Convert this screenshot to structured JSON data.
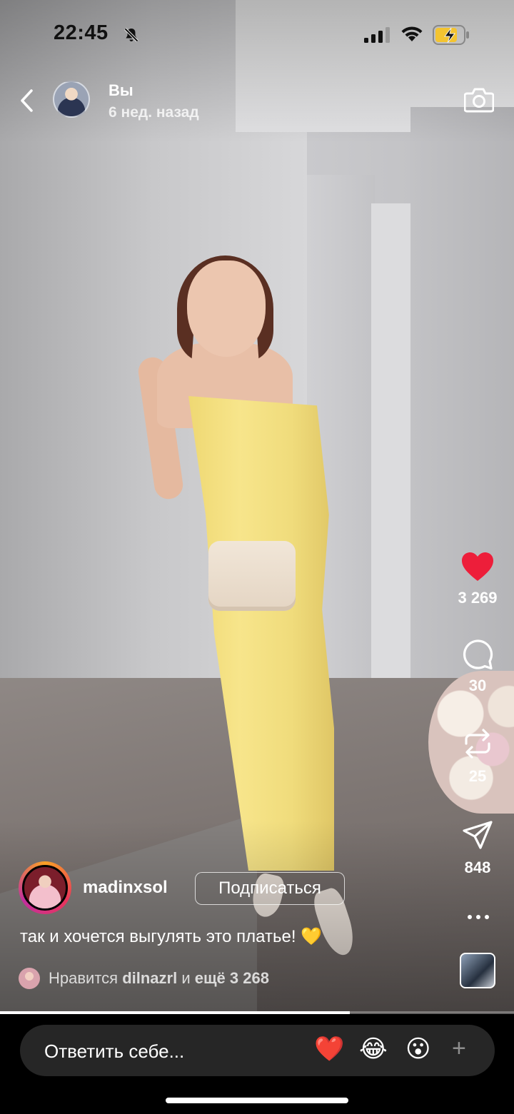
{
  "status_bar": {
    "time": "22:45",
    "icons": [
      "bell-slash-icon",
      "cellular-signal-icon",
      "wifi-icon",
      "battery-charging-icon"
    ]
  },
  "story": {
    "owner_name": "Вы",
    "posted_ago": "6 нед. назад"
  },
  "actions": {
    "likes": "3 269",
    "comments": "30",
    "reposts": "25",
    "shares": "848",
    "icons": [
      "heart-icon",
      "comment-icon",
      "repost-icon",
      "send-icon",
      "more-icon"
    ],
    "like_color": "#ED1E3A"
  },
  "post": {
    "author": "madinxsol",
    "follow_label": "Подписаться",
    "caption": "так и хочется выгулять это платье! 💛",
    "liked_prefix": "Нравится ",
    "liked_user": "dilnazrl",
    "liked_middle": " и ",
    "liked_rest": "ещё 3 268"
  },
  "progress": {
    "fraction": 0.68
  },
  "reply": {
    "placeholder": "Ответить себе...",
    "reactions": [
      "❤️",
      "😂",
      "😮"
    ],
    "add_label": "+"
  }
}
